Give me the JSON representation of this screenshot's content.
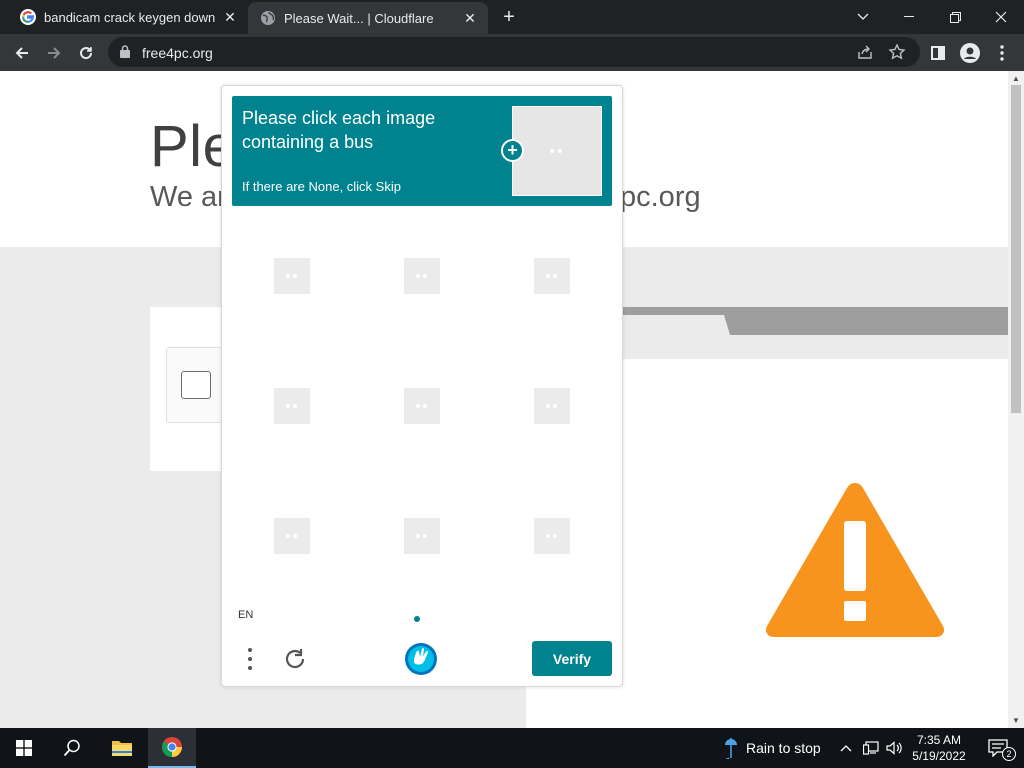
{
  "browser": {
    "tabs": [
      {
        "title": "bandicam crack keygen downloa",
        "icon": "google-icon",
        "active": false
      },
      {
        "title": "Please Wait... | Cloudflare",
        "icon": "globe-icon",
        "active": true
      }
    ],
    "url": "free4pc.org"
  },
  "page": {
    "headline": "Ple",
    "subline_left": "We ar",
    "subline_right": "pc.org"
  },
  "captcha": {
    "prompt": "Please click each image containing a bus",
    "hint": "If there are None, click Skip",
    "language": "EN",
    "verify_label": "Verify",
    "brand_color": "#00838f",
    "tile_count": 9
  },
  "taskbar": {
    "weather": "Rain to stop",
    "time": "7:35 AM",
    "date": "5/19/2022",
    "notification_count": "2"
  },
  "colors": {
    "warning": "#f7941d",
    "chrome_dark": "#202124",
    "chrome_toolbar": "#35363a"
  }
}
